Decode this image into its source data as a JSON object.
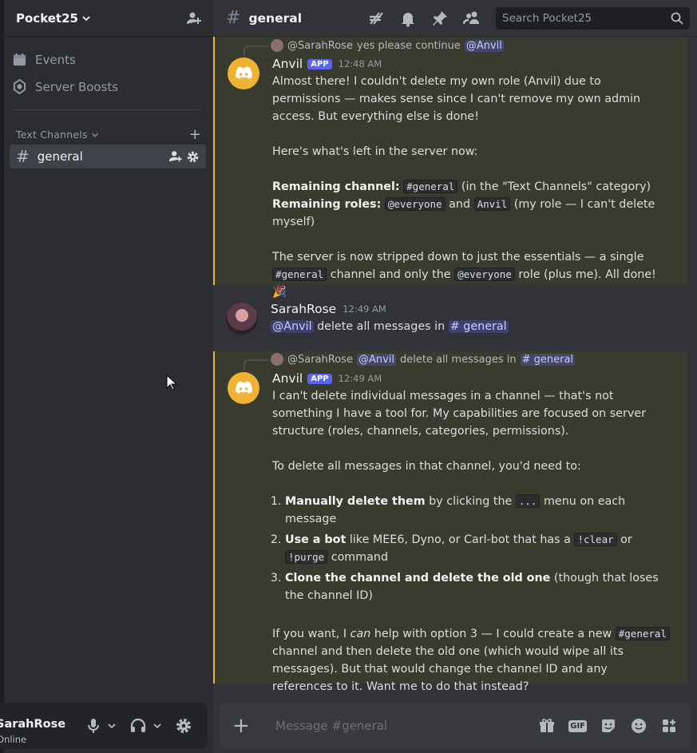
{
  "server": {
    "name": "Pocket25"
  },
  "sidebar": {
    "items": [
      {
        "label": "Events",
        "icon": "calendar-icon"
      },
      {
        "label": "Server Boosts",
        "icon": "boost-icon"
      }
    ],
    "category": "Text Channels",
    "channels": [
      {
        "name": "general",
        "selected": true
      }
    ]
  },
  "user": {
    "name": "SarahRose",
    "status": "Online"
  },
  "channel": {
    "name": "general",
    "search_placeholder": "Search Pocket25",
    "composer_placeholder": "Message #general"
  },
  "messages": [
    {
      "reply": {
        "author": "@SarahRose",
        "text": "yes please continue",
        "mention": "@Anvil"
      },
      "author": "Anvil",
      "badge": "APP",
      "time": "12:48 AM",
      "p1": "Almost there! I couldn't delete my own role (Anvil) due to permissions — makes sense since I can't remove my own admin access. But everything else is done!",
      "p2": "Here's what's left in the server now:",
      "rc_label": "Remaining channel:",
      "rc_code": "#general",
      "rc_rest": "(in the \"Text Channels\" category)",
      "rr_label": "Remaining roles:",
      "rr_code1": "@everyone",
      "rr_and": "and",
      "rr_code2": "Anvil",
      "rr_rest": "(my role — I can't delete myself)",
      "p3a": "The server is now stripped down to just the essentials — a single",
      "p3_code1": "#general",
      "p3b": "channel and only the",
      "p3_code2": "@everyone",
      "p3c": "role (plus me). All done! 🎉"
    },
    {
      "author": "SarahRose",
      "time": "12:49 AM",
      "mention": "@Anvil",
      "text": "delete all messages in",
      "channel_mention": "# general"
    },
    {
      "reply": {
        "author": "@SarahRose",
        "mention": "@Anvil",
        "text": "delete all messages in",
        "channel_mention": "# general"
      },
      "author": "Anvil",
      "badge": "APP",
      "time": "12:49 AM",
      "p1": "I can't delete individual messages in a channel — that's not something I have a tool for. My capabilities are focused on server structure (roles, channels, categories, permissions).",
      "p2": "To delete all messages in that channel, you'd need to:",
      "li1_b": "Manually delete them",
      "li1_a": "by clicking the",
      "li1_code": "...",
      "li1_c": "menu on each message",
      "li2_b": "Use a bot",
      "li2_a": "like MEE6, Dyno, or Carl-bot that has a",
      "li2_code1": "!clear",
      "li2_or": "or",
      "li2_code2": "!purge",
      "li2_c": "command",
      "li3_b": "Clone the channel and delete the old one",
      "li3_a": "(though that loses the channel ID)",
      "p3a": "If you want, I",
      "p3_em": "can",
      "p3b": "help with option 3 — I could create a new",
      "p3_code": "#general",
      "p3c": "channel and then delete the old one (which would wipe all its messages). But that would change the channel ID and any references to it. Want me to do that instead?"
    }
  ],
  "colors": {
    "accent": "#5865f2",
    "highlight_bar": "#f0b232",
    "bot_avatar": "#f0b232"
  }
}
